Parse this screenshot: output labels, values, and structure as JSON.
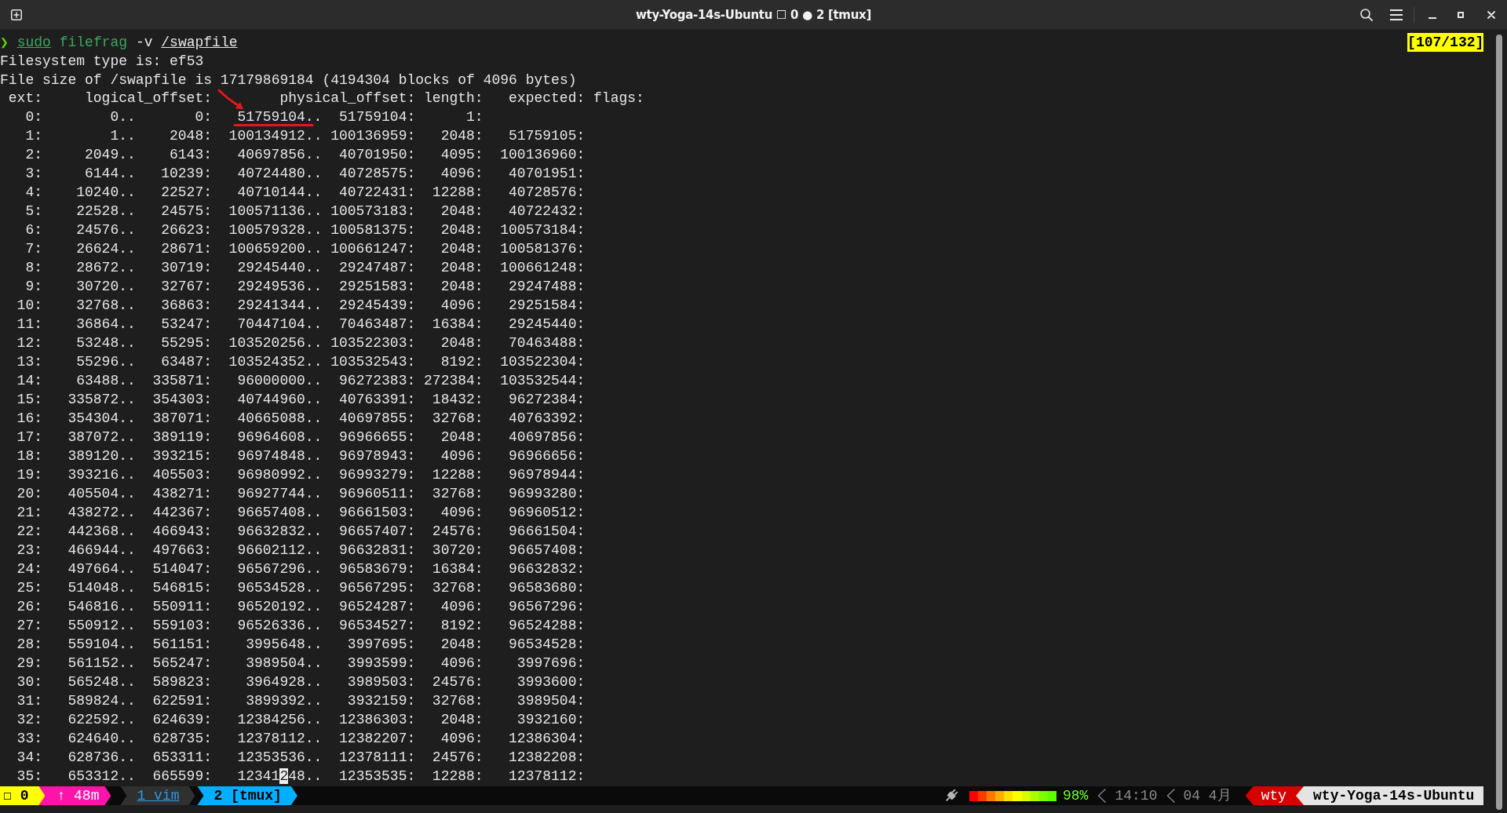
{
  "window": {
    "title": "wty-Yoga-14s-Ubuntu ☐ 0 ● 2 [tmux]"
  },
  "prompt": {
    "symbol": "❯",
    "tokens": [
      {
        "text": "sudo",
        "kind": "command",
        "underlined": true
      },
      {
        "text": "filefrag",
        "kind": "command",
        "underlined": false
      },
      {
        "text": "-v",
        "kind": "option",
        "underlined": false
      },
      {
        "text": "/swapfile",
        "kind": "argument",
        "underlined": true
      }
    ]
  },
  "position_indicator": "[107/132]",
  "output_lines": [
    "Filesystem type is: ef53",
    "File size of /swapfile is 17179869184 (4194304 blocks of 4096 bytes)"
  ],
  "table": {
    "columns": [
      "ext:",
      "logical_offset:",
      "physical_offset:",
      "length:",
      "expected:",
      "flags:"
    ],
    "rows": [
      {
        "ext": "0:",
        "logical_start": "0..",
        "logical_end": "0:",
        "physical_start": "51759104..",
        "physical_end": "51759104:",
        "length": "1:",
        "marked": true
      },
      {
        "ext": "1:",
        "logical_start": "1..",
        "logical_end": "2048:",
        "physical_start": "100134912..",
        "physical_end": "100136959:",
        "length": "2048:",
        "expected": "51759105:",
        "marked": false
      },
      {
        "ext": "2:",
        "logical_start": "2049..",
        "logical_end": "6143:",
        "physical_start": "40697856..",
        "physical_end": "40701950:",
        "length": "4095:",
        "expected": "100136960:",
        "marked": false
      },
      {
        "ext": "3:",
        "logical_start": "6144..",
        "logical_end": "10239:",
        "physical_start": "40724480..",
        "physical_end": "40728575:",
        "length": "4096:",
        "expected": "40701951:",
        "marked": false
      },
      {
        "ext": "4:",
        "logical_start": "10240..",
        "logical_end": "22527:",
        "physical_start": "40710144..",
        "physical_end": "40722431:",
        "length": "12288:",
        "expected": "40728576:",
        "marked": false
      },
      {
        "ext": "5:",
        "logical_start": "22528..",
        "logical_end": "24575:",
        "physical_start": "100571136..",
        "physical_end": "100573183:",
        "length": "2048:",
        "expected": "40722432:",
        "marked": false
      },
      {
        "ext": "6:",
        "logical_start": "24576..",
        "logical_end": "26623:",
        "physical_start": "100579328..",
        "physical_end": "100581375:",
        "length": "2048:",
        "expected": "100573184:",
        "marked": false
      },
      {
        "ext": "7:",
        "logical_start": "26624..",
        "logical_end": "28671:",
        "physical_start": "100659200..",
        "physical_end": "100661247:",
        "length": "2048:",
        "expected": "100581376:",
        "marked": false
      },
      {
        "ext": "8:",
        "logical_start": "28672..",
        "logical_end": "30719:",
        "physical_start": "29245440..",
        "physical_end": "29247487:",
        "length": "2048:",
        "expected": "100661248:",
        "marked": false
      },
      {
        "ext": "9:",
        "logical_start": "30720..",
        "logical_end": "32767:",
        "physical_start": "29249536..",
        "physical_end": "29251583:",
        "length": "2048:",
        "expected": "29247488:",
        "marked": false
      },
      {
        "ext": "10:",
        "logical_start": "32768..",
        "logical_end": "36863:",
        "physical_start": "29241344..",
        "physical_end": "29245439:",
        "length": "4096:",
        "expected": "29251584:",
        "marked": false
      },
      {
        "ext": "11:",
        "logical_start": "36864..",
        "logical_end": "53247:",
        "physical_start": "70447104..",
        "physical_end": "70463487:",
        "length": "16384:",
        "expected": "29245440:",
        "marked": false
      },
      {
        "ext": "12:",
        "logical_start": "53248..",
        "logical_end": "55295:",
        "physical_start": "103520256..",
        "physical_end": "103522303:",
        "length": "2048:",
        "expected": "70463488:",
        "marked": false
      },
      {
        "ext": "13:",
        "logical_start": "55296..",
        "logical_end": "63487:",
        "physical_start": "103524352..",
        "physical_end": "103532543:",
        "length": "8192:",
        "expected": "103522304:",
        "marked": false
      },
      {
        "ext": "14:",
        "logical_start": "63488..",
        "logical_end": "335871:",
        "physical_start": "96000000..",
        "physical_end": "96272383:",
        "length": "272384:",
        "expected": "103532544:",
        "marked": false
      },
      {
        "ext": "15:",
        "logical_start": "335872..",
        "logical_end": "354303:",
        "physical_start": "40744960..",
        "physical_end": "40763391:",
        "length": "18432:",
        "expected": "96272384:",
        "marked": false
      },
      {
        "ext": "16:",
        "logical_start": "354304..",
        "logical_end": "387071:",
        "physical_start": "40665088..",
        "physical_end": "40697855:",
        "length": "32768:",
        "expected": "40763392:",
        "marked": false
      },
      {
        "ext": "17:",
        "logical_start": "387072..",
        "logical_end": "389119:",
        "physical_start": "96964608..",
        "physical_end": "96966655:",
        "length": "2048:",
        "expected": "40697856:",
        "marked": false
      },
      {
        "ext": "18:",
        "logical_start": "389120..",
        "logical_end": "393215:",
        "physical_start": "96974848..",
        "physical_end": "96978943:",
        "length": "4096:",
        "expected": "96966656:",
        "marked": false
      },
      {
        "ext": "19:",
        "logical_start": "393216..",
        "logical_end": "405503:",
        "physical_start": "96980992..",
        "physical_end": "96993279:",
        "length": "12288:",
        "expected": "96978944:",
        "marked": false
      },
      {
        "ext": "20:",
        "logical_start": "405504..",
        "logical_end": "438271:",
        "physical_start": "96927744..",
        "physical_end": "96960511:",
        "length": "32768:",
        "expected": "96993280:",
        "marked": false
      },
      {
        "ext": "21:",
        "logical_start": "438272..",
        "logical_end": "442367:",
        "physical_start": "96657408..",
        "physical_end": "96661503:",
        "length": "4096:",
        "expected": "96960512:",
        "marked": false
      },
      {
        "ext": "22:",
        "logical_start": "442368..",
        "logical_end": "466943:",
        "physical_start": "96632832..",
        "physical_end": "96657407:",
        "length": "24576:",
        "expected": "96661504:",
        "marked": false
      },
      {
        "ext": "23:",
        "logical_start": "466944..",
        "logical_end": "497663:",
        "physical_start": "96602112..",
        "physical_end": "96632831:",
        "length": "30720:",
        "expected": "96657408:",
        "marked": false
      },
      {
        "ext": "24:",
        "logical_start": "497664..",
        "logical_end": "514047:",
        "physical_start": "96567296..",
        "physical_end": "96583679:",
        "length": "16384:",
        "expected": "96632832:",
        "marked": false
      },
      {
        "ext": "25:",
        "logical_start": "514048..",
        "logical_end": "546815:",
        "physical_start": "96534528..",
        "physical_end": "96567295:",
        "length": "32768:",
        "expected": "96583680:",
        "marked": false
      },
      {
        "ext": "26:",
        "logical_start": "546816..",
        "logical_end": "550911:",
        "physical_start": "96520192..",
        "physical_end": "96524287:",
        "length": "4096:",
        "expected": "96567296:",
        "marked": false
      },
      {
        "ext": "27:",
        "logical_start": "550912..",
        "logical_end": "559103:",
        "physical_start": "96526336..",
        "physical_end": "96534527:",
        "length": "8192:",
        "expected": "96524288:",
        "marked": false
      },
      {
        "ext": "28:",
        "logical_start": "559104..",
        "logical_end": "561151:",
        "physical_start": "3995648..",
        "physical_end": "3997695:",
        "length": "2048:",
        "expected": "96534528:",
        "marked": false
      },
      {
        "ext": "29:",
        "logical_start": "561152..",
        "logical_end": "565247:",
        "physical_start": "3989504..",
        "physical_end": "3993599:",
        "length": "4096:",
        "expected": "3997696:",
        "marked": false
      },
      {
        "ext": "30:",
        "logical_start": "565248..",
        "logical_end": "589823:",
        "physical_start": "3964928..",
        "physical_end": "3989503:",
        "length": "24576:",
        "expected": "3993600:",
        "marked": false
      },
      {
        "ext": "31:",
        "logical_start": "589824..",
        "logical_end": "622591:",
        "physical_start": "3899392..",
        "physical_end": "3932159:",
        "length": "32768:",
        "expected": "3989504:",
        "marked": false
      },
      {
        "ext": "32:",
        "logical_start": "622592..",
        "logical_end": "624639:",
        "physical_start": "12384256..",
        "physical_end": "12386303:",
        "length": "2048:",
        "expected": "3932160:",
        "marked": false
      },
      {
        "ext": "33:",
        "logical_start": "624640..",
        "logical_end": "628735:",
        "physical_start": "12378112..",
        "physical_end": "12382207:",
        "length": "4096:",
        "expected": "12386304:",
        "marked": false
      },
      {
        "ext": "34:",
        "logical_start": "628736..",
        "logical_end": "653311:",
        "physical_start": "12353536..",
        "physical_end": "12378111:",
        "length": "24576:",
        "expected": "12382208:",
        "marked": false
      },
      {
        "ext": "35:",
        "logical_start": "653312..",
        "logical_end": "665599:",
        "physical_start": {
          "before_cursor": "12341",
          "at_cursor": "2",
          "after_cursor": "48.."
        },
        "physical_end": "12353535:",
        "length": "12288:",
        "expected": "12378112:",
        "marked": false
      }
    ]
  },
  "status_bar": {
    "session": "☐ 0",
    "uptime": "↑ 48m",
    "windows": [
      {
        "text": "1 vim",
        "selected": false
      },
      {
        "text": "2 [tmux]",
        "selected": true
      }
    ],
    "charging": true,
    "battery": {
      "level": 0.98,
      "reading": "98%"
    },
    "time": "14:10",
    "date": "04 4月",
    "user": "wty",
    "host": "wty-Yoga-14s-Ubuntu"
  }
}
